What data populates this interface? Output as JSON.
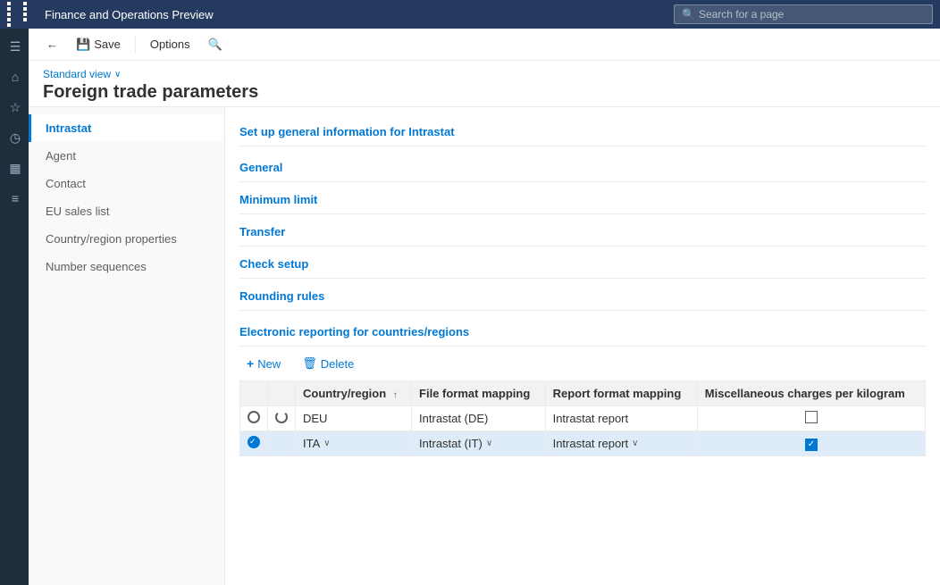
{
  "topnav": {
    "app_title": "Finance and Operations Preview",
    "search_placeholder": "Search for a page"
  },
  "toolbar": {
    "back_label": "",
    "save_label": "Save",
    "options_label": "Options",
    "search_label": ""
  },
  "page": {
    "view_label": "Standard view",
    "title": "Foreign trade parameters"
  },
  "left_nav": {
    "items": [
      {
        "id": "intrastat",
        "label": "Intrastat",
        "active": true
      },
      {
        "id": "agent",
        "label": "Agent",
        "active": false
      },
      {
        "id": "contact",
        "label": "Contact",
        "active": false
      },
      {
        "id": "eu-sales-list",
        "label": "EU sales list",
        "active": false
      },
      {
        "id": "country-region",
        "label": "Country/region properties",
        "active": false
      },
      {
        "id": "number-sequences",
        "label": "Number sequences",
        "active": false
      }
    ]
  },
  "main": {
    "subtitle": "Set up general information for Intrastat",
    "sections": [
      {
        "id": "general",
        "label": "General"
      },
      {
        "id": "minimum-limit",
        "label": "Minimum limit"
      },
      {
        "id": "transfer",
        "label": "Transfer"
      },
      {
        "id": "check-setup",
        "label": "Check setup"
      },
      {
        "id": "rounding-rules",
        "label": "Rounding rules"
      }
    ],
    "electronic_section_title": "Electronic reporting for countries/regions",
    "table_new_label": "New",
    "table_delete_label": "Delete",
    "table_headers": [
      {
        "id": "radio",
        "label": ""
      },
      {
        "id": "refresh",
        "label": ""
      },
      {
        "id": "country_region",
        "label": "Country/region",
        "sortable": true
      },
      {
        "id": "file_format",
        "label": "File format mapping"
      },
      {
        "id": "report_format",
        "label": "Report format mapping"
      },
      {
        "id": "misc_charges",
        "label": "Miscellaneous charges per kilogram"
      }
    ],
    "table_rows": [
      {
        "id": "row1",
        "selected": false,
        "country_region": "DEU",
        "file_format": "Intrastat (DE)",
        "report_format": "Intrastat report",
        "misc_checked": false
      },
      {
        "id": "row2",
        "selected": true,
        "country_region": "ITA",
        "file_format": "Intrastat (IT)",
        "report_format": "Intrastat report",
        "misc_checked": true
      }
    ]
  },
  "icons": {
    "home": "⌂",
    "star": "☆",
    "clock": "○",
    "grid": "▦",
    "list": "≡",
    "search": "🔍",
    "save": "💾",
    "back": "←",
    "plus": "+",
    "trash": "🗑",
    "chevron_down": "∨",
    "sort_up": "↑"
  }
}
